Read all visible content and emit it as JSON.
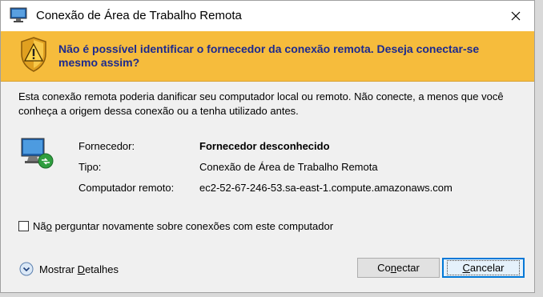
{
  "window": {
    "title": "Conexão de Área de Trabalho Remota",
    "close_glyph": "✕"
  },
  "warning": {
    "text": "Não é possível identificar o fornecedor da conexão remota. Deseja conectar-se mesmo assim?",
    "background": "#f6bc3c",
    "text_color": "#1c2a8f"
  },
  "description": "Esta conexão remota poderia danificar seu computador local ou remoto. Não conecte, a menos que você conheça a origem dessa conexão ou a tenha utilizado antes.",
  "details": [
    {
      "label": "Fornecedor:",
      "value": "Fornecedor desconhecido"
    },
    {
      "label": "Tipo:",
      "value": "Conexão de Área de Trabalho Remota"
    },
    {
      "label": "Computador remoto:",
      "value": "ec2-52-67-246-53.sa-east-1.compute.amazonaws.com"
    }
  ],
  "checkbox": {
    "label_pre": "Nã",
    "label_accel": "o",
    "label_post": " perguntar novamente sobre conexões com este computador",
    "checked": false
  },
  "show_details": {
    "label_pre": "Mostrar ",
    "label_accel": "D",
    "label_post": "etalhes"
  },
  "buttons": {
    "connect": {
      "pre": "Co",
      "accel": "n",
      "post": "ectar"
    },
    "cancel": {
      "pre": "",
      "accel": "C",
      "post": "ancelar"
    }
  },
  "icons": {
    "app": "remote-desktop-icon",
    "warning": "warning-shield-icon",
    "monitor": "remote-computer-icon",
    "expand": "chevron-down-circle-icon",
    "close": "close-icon"
  },
  "colors": {
    "accent": "#0078d7"
  }
}
